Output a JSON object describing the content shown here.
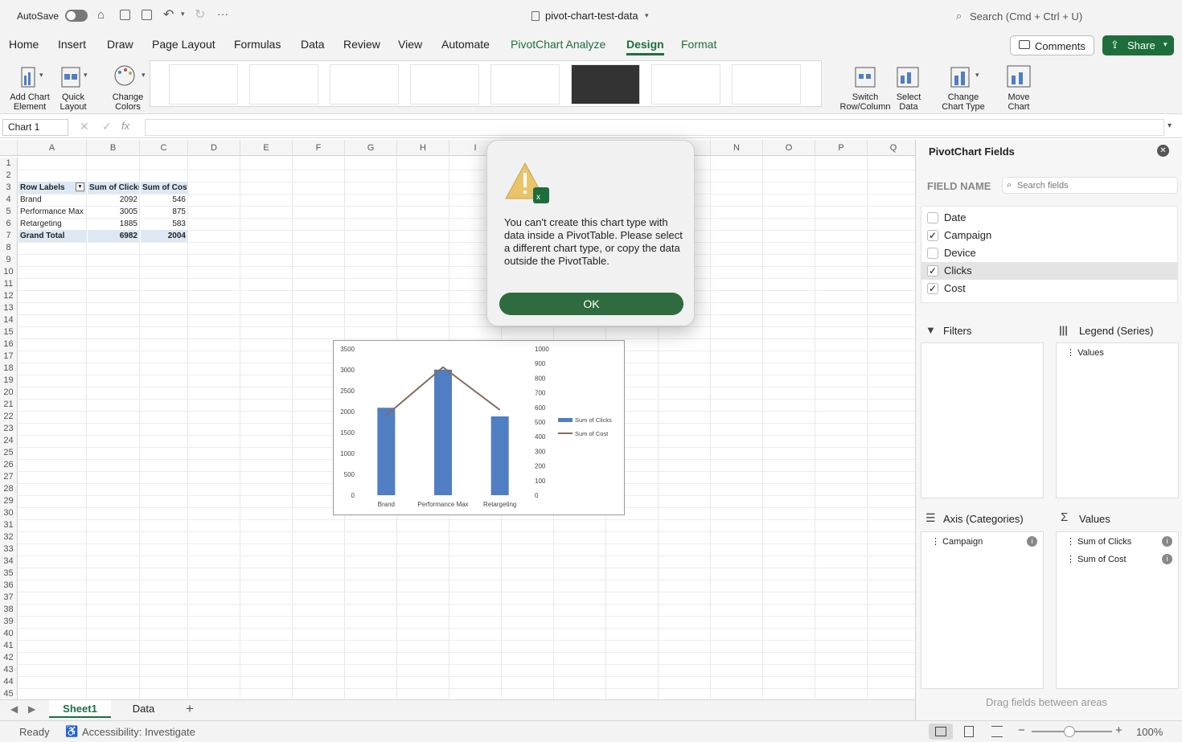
{
  "titlebar": {
    "autosave": "AutoSave",
    "filename": "pivot-chart-test-data",
    "search": "Search (Cmd + Ctrl + U)"
  },
  "tabs": [
    "Home",
    "Insert",
    "Draw",
    "Page Layout",
    "Formulas",
    "Data",
    "Review",
    "View",
    "Automate",
    "PivotChart Analyze",
    "Design",
    "Format"
  ],
  "top_buttons": {
    "comments": "Comments",
    "share": "Share"
  },
  "ribbon": {
    "add_chart": [
      "Add Chart",
      "Element"
    ],
    "quick_layout": [
      "Quick",
      "Layout"
    ],
    "change_colors": [
      "Change",
      "Colors"
    ],
    "switch": [
      "Switch",
      "Row/Column"
    ],
    "select_data": [
      "Select",
      "Data"
    ],
    "change_type": [
      "Change",
      "Chart Type"
    ],
    "move_chart": [
      "Move",
      "Chart"
    ]
  },
  "namebox": "Chart 1",
  "fx": "fx",
  "columns": [
    "A",
    "B",
    "C",
    "D",
    "E",
    "F",
    "G",
    "H",
    "I",
    "J",
    "K",
    "L",
    "M",
    "N",
    "O",
    "P",
    "Q"
  ],
  "rows": [
    "1",
    "2",
    "3",
    "4",
    "5",
    "6",
    "7",
    "8",
    "9",
    "10",
    "11",
    "12",
    "13",
    "14",
    "15",
    "16",
    "17",
    "18",
    "19",
    "20",
    "21",
    "22",
    "23",
    "24",
    "25",
    "26",
    "27",
    "28",
    "29",
    "30",
    "31",
    "32",
    "33",
    "34",
    "35",
    "36",
    "37",
    "38",
    "39",
    "40",
    "41",
    "42",
    "43",
    "44",
    "45"
  ],
  "pivot": {
    "headers": [
      "Row Labels",
      "Sum of Clicks",
      "Sum of Cost"
    ],
    "rows": [
      [
        "Brand",
        "2092",
        "546"
      ],
      [
        "Performance Max",
        "3005",
        "875"
      ],
      [
        "Retargeting",
        "1885",
        "583"
      ]
    ],
    "total": [
      "Grand Total",
      "6982",
      "2004"
    ]
  },
  "chart_data": {
    "type": "bar",
    "categories": [
      "Brand",
      "Performance Max",
      "Retargeting"
    ],
    "series": [
      {
        "name": "Sum of Clicks",
        "type": "bar",
        "values": [
          2092,
          3005,
          1885
        ],
        "axis": "left"
      },
      {
        "name": "Sum of Cost",
        "type": "line",
        "values": [
          546,
          875,
          583
        ],
        "axis": "right"
      }
    ],
    "ylim": [
      0,
      3500
    ],
    "y2lim": [
      0,
      1000
    ],
    "yticks": [
      "0",
      "500",
      "1000",
      "1500",
      "2000",
      "2500",
      "3000",
      "3500"
    ],
    "y2ticks": [
      "0",
      "100",
      "200",
      "300",
      "400",
      "500",
      "600",
      "700",
      "800",
      "900",
      "1000"
    ],
    "colors": {
      "bar": "#4f7ec3",
      "line": "#8a6a5c"
    },
    "legend": "right"
  },
  "dialog": {
    "message": "You can't create this chart type with data inside a PivotTable. Please select a different chart type, or copy the data outside the PivotTable.",
    "ok": "OK"
  },
  "pane": {
    "title": "PivotChart Fields",
    "field_name": "FIELD NAME",
    "search": "Search fields",
    "fields": [
      {
        "name": "Date",
        "checked": ""
      },
      {
        "name": "Campaign",
        "checked": "✓"
      },
      {
        "name": "Device",
        "checked": ""
      },
      {
        "name": "Clicks",
        "checked": "✓"
      },
      {
        "name": "Cost",
        "checked": "✓"
      }
    ],
    "filters": "Filters",
    "legend": "Legend (Series)",
    "legend_items": [
      "Values"
    ],
    "axis": "Axis (Categories)",
    "axis_items": [
      "Campaign"
    ],
    "values": "Values",
    "values_items": [
      "Sum of Clicks",
      "Sum of Cost"
    ],
    "drag_hint": "Drag fields between areas"
  },
  "sheets": [
    "Sheet1",
    "Data"
  ],
  "status": {
    "ready": "Ready",
    "accessibility": "Accessibility: Investigate",
    "zoom": "100%"
  },
  "accent": "#1e6e3c"
}
